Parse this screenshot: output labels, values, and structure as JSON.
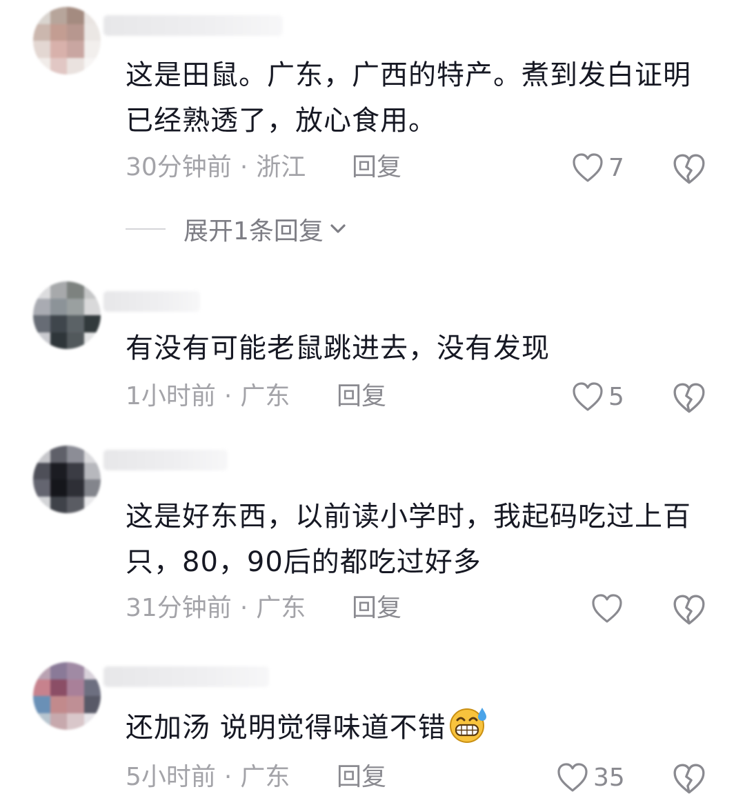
{
  "colors": {
    "text": "#161823",
    "meta": "#a3a3a8",
    "icon": "#8a8a90",
    "emoji_face": "#f8c33d",
    "emoji_sweat": "#4aa3e8"
  },
  "comments": [
    {
      "text": "这是田鼠。广东，广西的特产。煮到发白证明已经熟透了，放心食用。",
      "time": "30分钟前",
      "separator": "·",
      "location": "浙江",
      "reply_label": "回复",
      "like_count": "7",
      "expand_label": "展开1条回复"
    },
    {
      "text": "有没有可能老鼠跳进去，没有发现",
      "time": "1小时前",
      "separator": "·",
      "location": "广东",
      "reply_label": "回复",
      "like_count": "5"
    },
    {
      "text": "这是好东西，以前读小学时，我起码吃过上百只，80，90后的都吃过好多",
      "time": "31分钟前",
      "separator": "·",
      "location": "广东",
      "reply_label": "回复",
      "like_count": ""
    },
    {
      "text": "还加汤 说明觉得味道不错",
      "emoji": "grinning-sweat-emoji",
      "time": "5小时前",
      "separator": "·",
      "location": "广东",
      "reply_label": "回复",
      "like_count": "35"
    }
  ]
}
